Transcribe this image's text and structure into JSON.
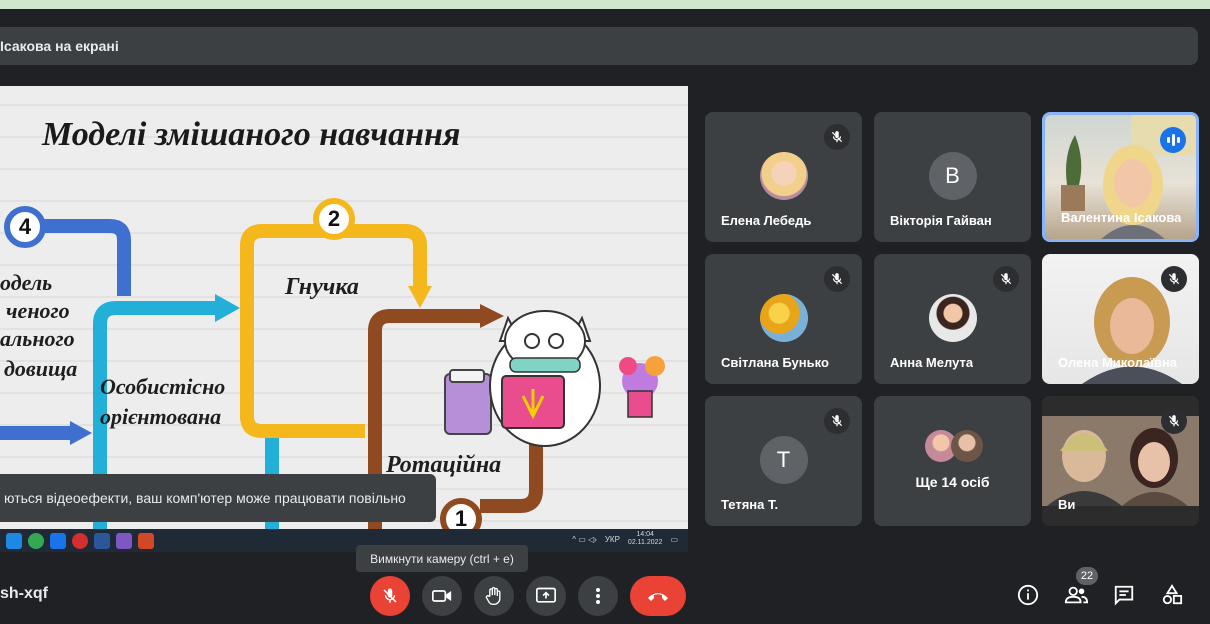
{
  "presenting": {
    "text": "Ісакова на екрані"
  },
  "slide": {
    "title": "Моделі змішаного навчання",
    "labels": {
      "model": "одель",
      "l2": "ченого",
      "l3": "ального",
      "l4": "довища",
      "personal1": "Особистісно",
      "personal2": "орієнтована",
      "flexible": "Гнучка",
      "rotation": "Ротаційна"
    },
    "badges": {
      "b1": "1",
      "b2": "2",
      "b4": "4"
    }
  },
  "taskbar": {
    "lang": "УКР",
    "time": "14:04",
    "date": "02.11.2022"
  },
  "warning": "ються відеоефекти, ваш комп'ютер може працювати повільно",
  "tooltip": "Вимкнути камеру (ctrl + e)",
  "meeting_code": "sh-xqf",
  "participants": [
    {
      "name": "Елена Лебедь",
      "mic": "muted"
    },
    {
      "name": "Вікторія Гайван",
      "initial": "В",
      "mic": "none",
      "avatar_color": "#5f6368"
    },
    {
      "name": "Валентина Ісакова",
      "mic": "speaking"
    },
    {
      "name": "Світлана Бунько",
      "mic": "muted"
    },
    {
      "name": "Анна Мелута",
      "mic": "muted"
    },
    {
      "name": "Олена Миколаївна",
      "mic": "muted"
    },
    {
      "name": "Тетяна Т.",
      "initial": "Т",
      "mic": "muted",
      "avatar_color": "#5f6368"
    },
    {
      "name": "Ще 14 осіб"
    },
    {
      "name": "Ви",
      "mic": "muted"
    }
  ],
  "people_count": "22",
  "colors": {
    "accent": "#8ab4f8",
    "danger": "#ea4335",
    "tile": "#3c4043",
    "bg": "#202124"
  }
}
